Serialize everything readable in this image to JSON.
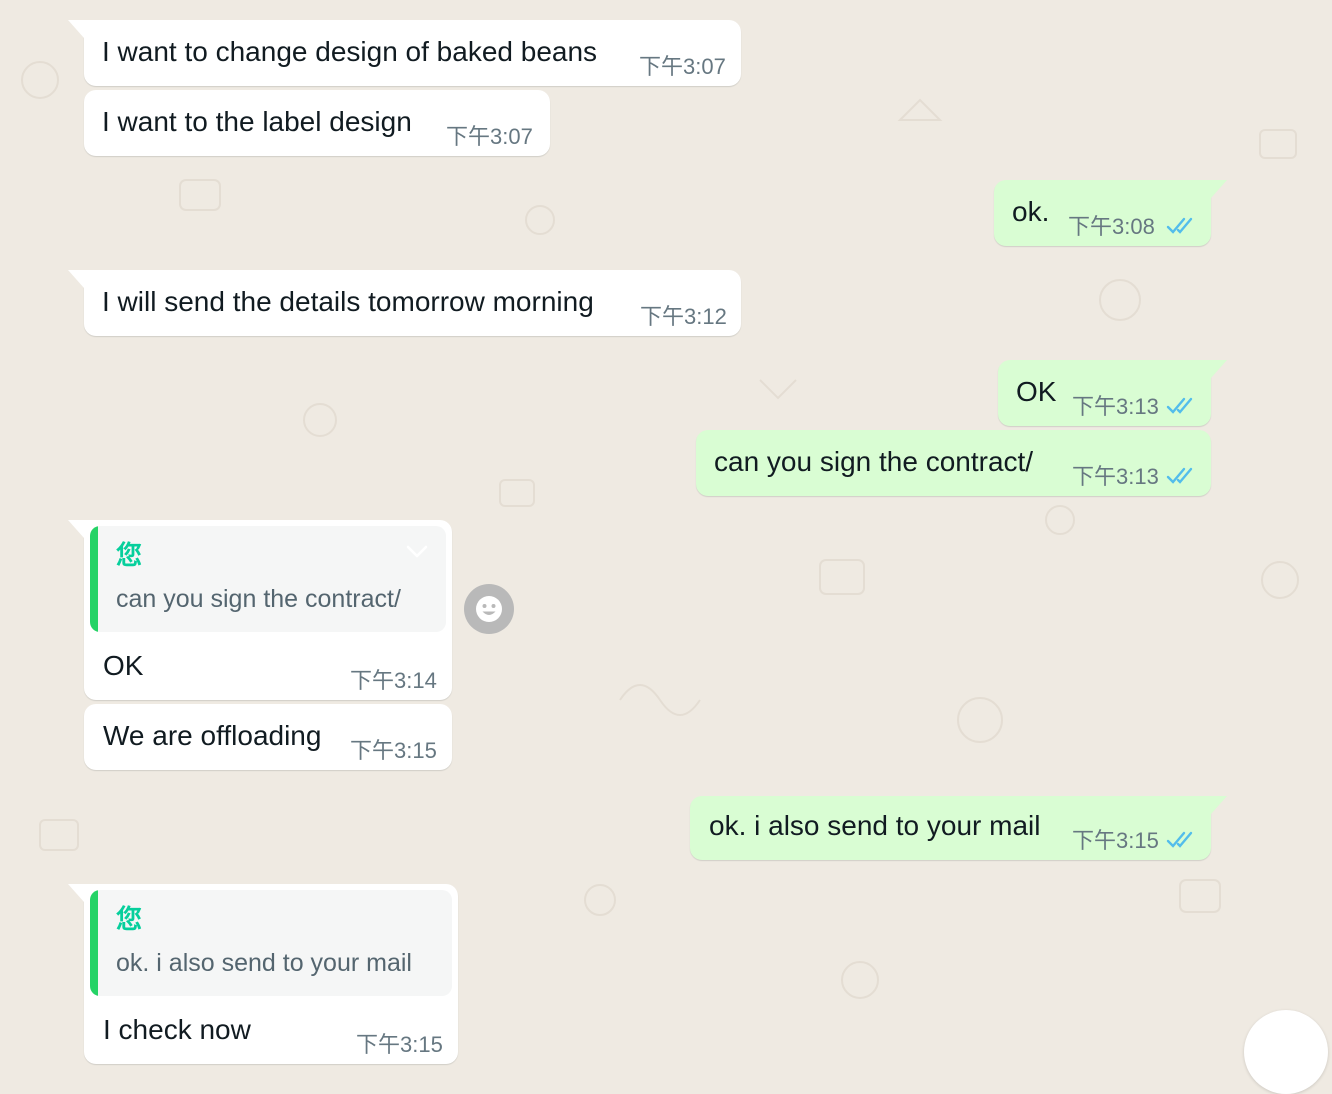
{
  "colors": {
    "background": "#efeae2",
    "incoming_bubble": "#ffffff",
    "outgoing_bubble": "#d9fdd3",
    "read_ticks": "#53bdeb",
    "quote_accent": "#25d366",
    "quote_author": "#06cf9c"
  },
  "messages": [
    {
      "direction": "in",
      "text": "I want to change design of baked beans",
      "time": "下午3:07"
    },
    {
      "direction": "in",
      "text": "I want to the label design",
      "time": "下午3:07"
    },
    {
      "direction": "out",
      "text": "ok.",
      "time": "下午3:08",
      "status": "read"
    },
    {
      "direction": "in",
      "text": "I will send the details tomorrow morning",
      "time": "下午3:12"
    },
    {
      "direction": "out",
      "text": "OK",
      "time": "下午3:13",
      "status": "read"
    },
    {
      "direction": "out",
      "text": "can you sign the contract/",
      "time": "下午3:13",
      "status": "read"
    },
    {
      "direction": "in",
      "quote": {
        "author": "您",
        "text": "can you sign the contract/"
      },
      "text": "OK",
      "time": "下午3:14"
    },
    {
      "direction": "in",
      "text": "We are offloading",
      "time": "下午3:15"
    },
    {
      "direction": "out",
      "text": "ok. i also send to your mail",
      "time": "下午3:15",
      "status": "read"
    },
    {
      "direction": "in",
      "quote": {
        "author": "您",
        "text": "ok. i also send to your mail"
      },
      "text": "I check now",
      "time": "下午3:15"
    }
  ],
  "icons": {
    "reaction": "smiley-icon",
    "menu": "chevron-down-icon",
    "status": "double-check-icon",
    "scroll": "scroll-down-button"
  }
}
